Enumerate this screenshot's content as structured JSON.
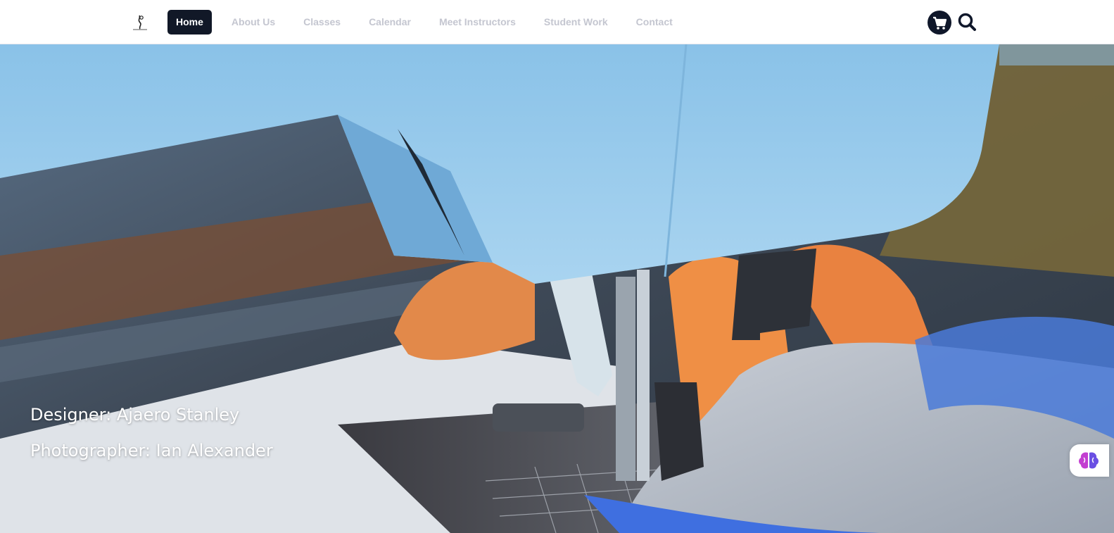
{
  "header": {
    "logo_icon": "needle-thread-logo-icon",
    "nav": [
      {
        "label": "Home",
        "active": true
      },
      {
        "label": "About Us",
        "active": false
      },
      {
        "label": "Classes",
        "active": false
      },
      {
        "label": "Calendar",
        "active": false
      },
      {
        "label": "Meet Instructors",
        "active": false
      },
      {
        "label": "Student Work",
        "active": false
      },
      {
        "label": "Contact",
        "active": false
      }
    ],
    "cart_icon": "cart-icon",
    "search_icon": "search-icon"
  },
  "hero": {
    "designer_credit": "Designer: Ajaero Stanley",
    "photographer_credit": "Photographer: Ian Alexander"
  },
  "assistant": {
    "icon": "brain-icon"
  },
  "colors": {
    "nav_active_bg": "#111827",
    "nav_inactive_text": "#c4c6d0",
    "machine_blue": "#8fc6ea"
  }
}
